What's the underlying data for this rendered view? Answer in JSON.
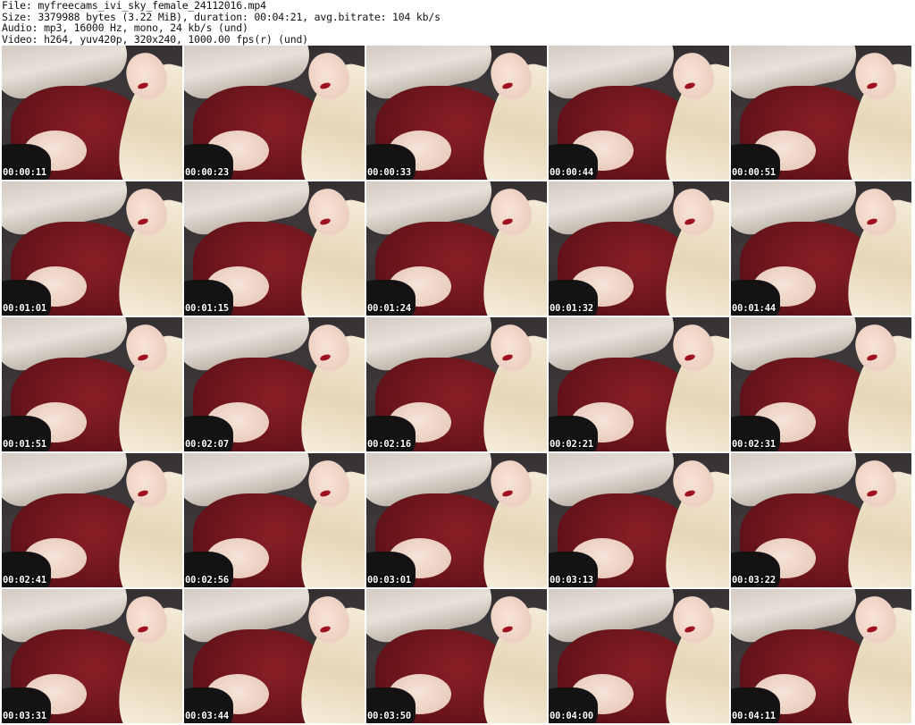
{
  "header": {
    "file_line": "File: myfreecams_ivi_sky_female_24112016.mp4",
    "size_line": "Size: 3379988 bytes (3.22 MiB), duration: 00:04:21, avg.bitrate: 104 kb/s",
    "audio_line": "Audio: mp3, 16000 Hz, mono, 24 kb/s (und)",
    "video_line": "Video: h264, yuv420p, 320x240, 1000.00 fps(r) (und)"
  },
  "thumbnails": [
    {
      "timestamp": "00:00:11"
    },
    {
      "timestamp": "00:00:23"
    },
    {
      "timestamp": "00:00:33"
    },
    {
      "timestamp": "00:00:44"
    },
    {
      "timestamp": "00:00:51"
    },
    {
      "timestamp": "00:01:01"
    },
    {
      "timestamp": "00:01:15"
    },
    {
      "timestamp": "00:01:24"
    },
    {
      "timestamp": "00:01:32"
    },
    {
      "timestamp": "00:01:44"
    },
    {
      "timestamp": "00:01:51"
    },
    {
      "timestamp": "00:02:07"
    },
    {
      "timestamp": "00:02:16"
    },
    {
      "timestamp": "00:02:21"
    },
    {
      "timestamp": "00:02:31"
    },
    {
      "timestamp": "00:02:41"
    },
    {
      "timestamp": "00:02:56"
    },
    {
      "timestamp": "00:03:01"
    },
    {
      "timestamp": "00:03:13"
    },
    {
      "timestamp": "00:03:22"
    },
    {
      "timestamp": "00:03:31"
    },
    {
      "timestamp": "00:03:44"
    },
    {
      "timestamp": "00:03:50"
    },
    {
      "timestamp": "00:04:00"
    },
    {
      "timestamp": "00:04:11"
    }
  ]
}
